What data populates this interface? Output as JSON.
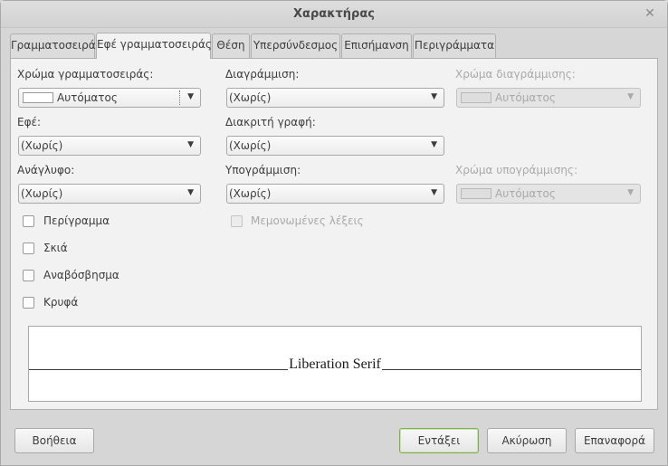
{
  "window": {
    "title": "Χαρακτήρας"
  },
  "tabs": [
    {
      "label": "Γραμματοσειρά"
    },
    {
      "label": "Εφέ γραμματοσειράς"
    },
    {
      "label": "Θέση"
    },
    {
      "label": "Υπερσύνδεσμος"
    },
    {
      "label": "Επισήμανση"
    },
    {
      "label": "Περιγράμματα"
    }
  ],
  "font_effects": {
    "font_color": {
      "label": "Χρώμα γραμματοσειράς:",
      "value": "Αυτόματος"
    },
    "strikethrough": {
      "label": "Διαγράμμιση:",
      "value": "(Χωρίς)"
    },
    "strikethrough_color": {
      "label": "Χρώμα διαγράμμισης:",
      "value": "Αυτόματος"
    },
    "effects": {
      "label": "Εφέ:",
      "value": "(Χωρίς)"
    },
    "case": {
      "label": "Διακριτή γραφή:",
      "value": "(Χωρίς)"
    },
    "relief": {
      "label": "Ανάγλυφο:",
      "value": "(Χωρίς)"
    },
    "underline": {
      "label": "Υπογράμμιση:",
      "value": "(Χωρίς)"
    },
    "underline_color": {
      "label": "Χρώμα υπογράμμισης:",
      "value": "Αυτόματος"
    },
    "checkboxes": {
      "outline": "Περίγραμμα",
      "shadow": "Σκιά",
      "blinking": "Αναβόσβησμα",
      "hidden": "Κρυφά"
    },
    "individual_words": "Μεμονωμένες λέξεις"
  },
  "preview": {
    "text": "Liberation Serif"
  },
  "buttons": {
    "help": "Βοήθεια",
    "ok": "Εντάξει",
    "cancel": "Ακύρωση",
    "reset": "Επαναφορά"
  }
}
